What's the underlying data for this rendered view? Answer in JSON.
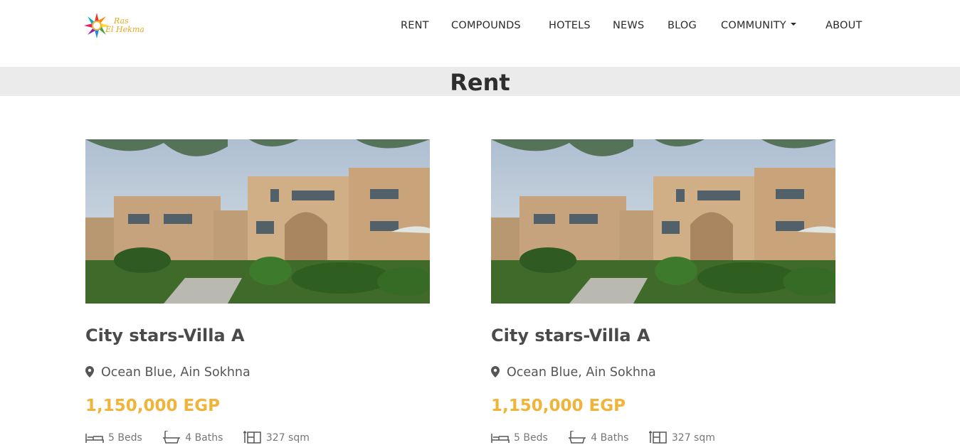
{
  "header": {
    "logo": {
      "text_line1": "Ras",
      "text_line2": "El Hekma"
    },
    "nav": [
      {
        "label": "RENT"
      },
      {
        "label": "COMPOUNDS"
      },
      {
        "label": "HOTELS"
      },
      {
        "label": "NEWS"
      },
      {
        "label": "BLOG"
      },
      {
        "label": "COMMUNITY",
        "has_dropdown": true
      },
      {
        "label": "ABOUT"
      }
    ]
  },
  "page": {
    "title": "Rent"
  },
  "listings": [
    {
      "title": "City stars-Villa A",
      "location": "Ocean Blue, Ain Sokhna",
      "price": "1,150,000 EGP",
      "beds": "5 Beds",
      "baths": "4 Baths",
      "area": "327 sqm"
    },
    {
      "title": "City stars-Villa A",
      "location": "Ocean Blue, Ain Sokhna",
      "price": "1,150,000 EGP",
      "beds": "5 Beds",
      "baths": "4 Baths",
      "area": "327 sqm"
    }
  ],
  "colors": {
    "accent_price": "#f0b43a",
    "title_band": "#ebebeb",
    "logo_text": "#e5a823"
  },
  "icons": {
    "location": "map-pin-icon",
    "beds": "bed-icon",
    "baths": "bath-icon",
    "area": "area-icon",
    "dropdown": "caret-down-icon"
  }
}
